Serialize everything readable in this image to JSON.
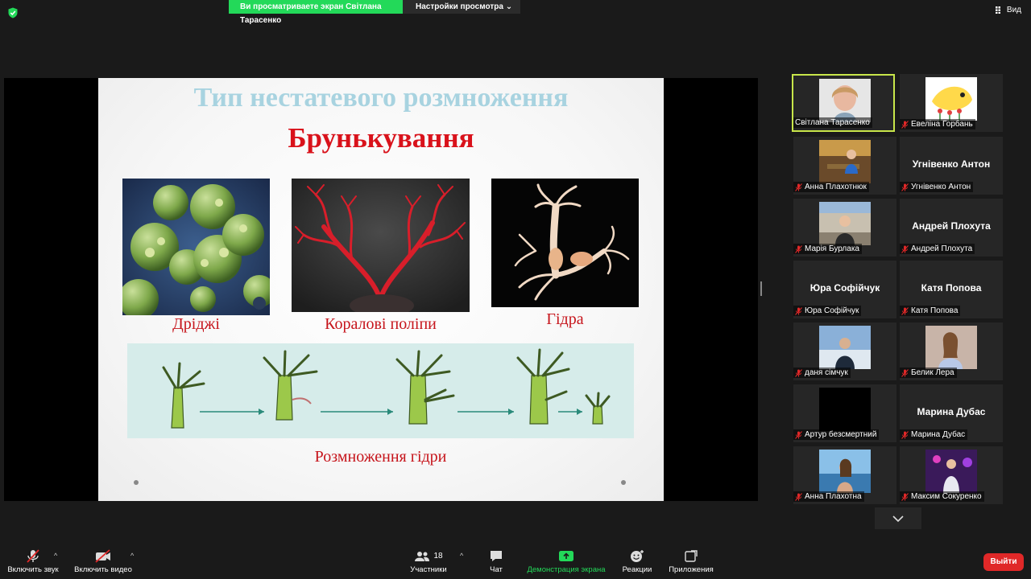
{
  "top_bar": {
    "share_banner": "Ви просматриваете экран Світлана Тарасенко",
    "view_options": "Настройки просмотра",
    "view_button": "Вид"
  },
  "slide": {
    "title": "Тип нестатевого розмноження",
    "subtitle": "Брунькування",
    "captions": {
      "yeast": "Дріджі",
      "coral": "Коралові поліпи",
      "hydra": "Гідра",
      "stages": "Розмноження гідри"
    }
  },
  "participants": [
    {
      "name": "Світлана Тарасенко",
      "muted": false,
      "video": true,
      "active": true
    },
    {
      "name": "Евеліна Горбань",
      "muted": true,
      "video": true
    },
    {
      "name": "Анна Плахотнюк",
      "muted": true,
      "video": true
    },
    {
      "name": "Угнівенко Антон",
      "muted": true,
      "video": false
    },
    {
      "name": "Марія Бурлака",
      "muted": true,
      "video": true
    },
    {
      "name": "Андрей Плохута",
      "muted": true,
      "video": false
    },
    {
      "name": "Юра Софійчук",
      "muted": true,
      "video": false
    },
    {
      "name": "Катя Попова",
      "muted": true,
      "video": false
    },
    {
      "name": "даня сімчук",
      "muted": true,
      "video": true
    },
    {
      "name": "Белик Лера",
      "muted": true,
      "video": true
    },
    {
      "name": "Артур безсмертний",
      "muted": true,
      "video": true
    },
    {
      "name": "Марина Дубас",
      "muted": true,
      "video": false
    },
    {
      "name": "Анна Плахотна",
      "muted": true,
      "video": true
    },
    {
      "name": "Максим Сокуренко",
      "muted": true,
      "video": true
    }
  ],
  "toolbar": {
    "unmute": "Включить звук",
    "start_video": "Включить видео",
    "participants": "Участники",
    "participants_count": "18",
    "chat": "Чат",
    "share_screen": "Демонстрация экрана",
    "reactions": "Реакции",
    "apps": "Приложения",
    "leave": "Выйти"
  },
  "colors": {
    "share_green": "#23d959",
    "active_speaker": "#c8e64a",
    "leave_red": "#e02828",
    "muted_red": "#e02828",
    "slide_title": "#a8d3e0",
    "slide_subtitle": "#d9121b"
  }
}
